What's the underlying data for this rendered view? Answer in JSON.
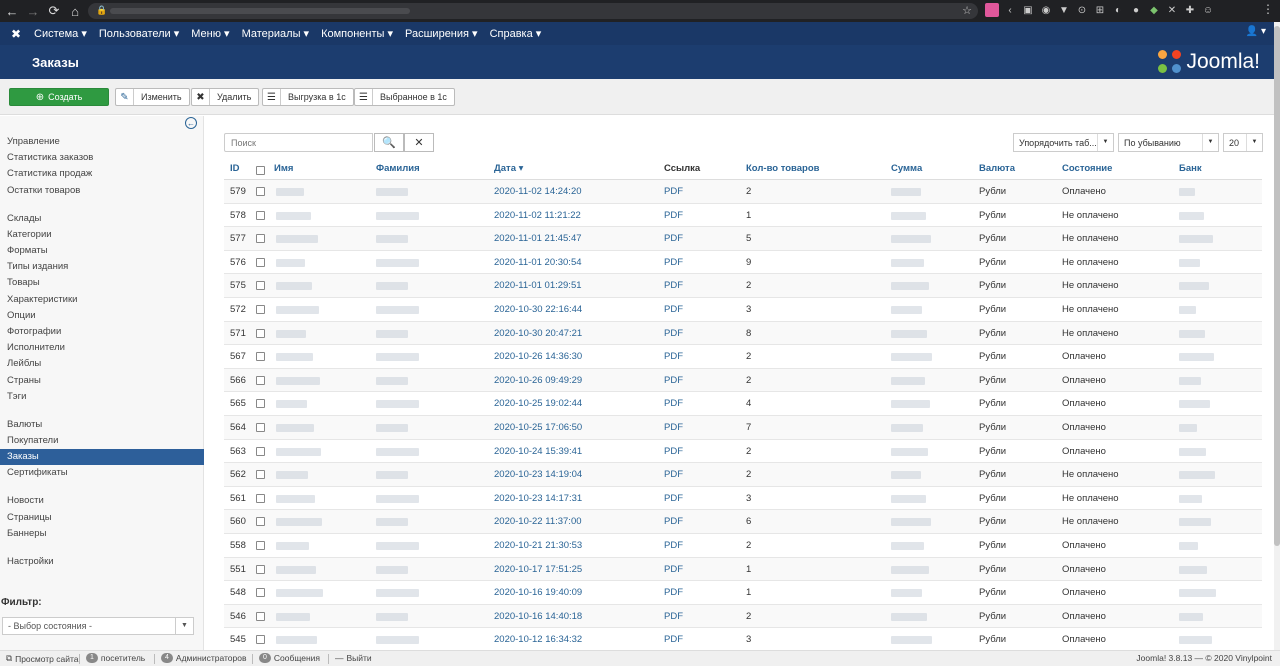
{
  "topnav": {
    "items": [
      "Система ▾",
      "Пользователи ▾",
      "Меню ▾",
      "Материалы ▾",
      "Компоненты ▾",
      "Расширения ▾",
      "Справка ▾"
    ],
    "user": "👤 ▾"
  },
  "header": {
    "title": "Заказы",
    "logo_text": "Joomla!"
  },
  "toolbar": {
    "create": "Создать",
    "edit": "Изменить",
    "delete": "Удалить",
    "export": "Выгрузка в 1с",
    "export_selected": "Выбранное в 1с"
  },
  "sidebar": {
    "items": [
      "Управление",
      "Статистика заказов",
      "Статистика продаж",
      "Остатки товаров",
      "Склады",
      "Категории",
      "Форматы",
      "Типы издания",
      "Товары",
      "Характеристики",
      "Опции",
      "Фотографии",
      "Исполнители",
      "Лейблы",
      "Страны",
      "Тэги",
      "Валюты",
      "Покупатели",
      "Заказы",
      "Сертификаты",
      "Новости",
      "Страницы",
      "Баннеры",
      "Настройки"
    ],
    "active": "Заказы",
    "filter_title": "Фильтр:",
    "filter_select": "- Выбор состояния -"
  },
  "search": {
    "placeholder": "Поиск"
  },
  "sorting": {
    "order_by": "Упорядочить таб...",
    "direction": "По убыванию",
    "limit": "20"
  },
  "table": {
    "headers": {
      "id": "ID",
      "first_name": "Имя",
      "last_name": "Фамилия",
      "date": "Дата ▾",
      "link": "Ссылка",
      "qty": "Кол-во товаров",
      "sum": "Сумма",
      "currency": "Валюта",
      "state": "Состояние",
      "bank": "Банк"
    },
    "rows": [
      {
        "id": "579",
        "date": "2020-11-02 14:24:20",
        "link": "PDF",
        "qty": "2",
        "currency": "Рубли",
        "state": "Оплачено"
      },
      {
        "id": "578",
        "date": "2020-11-02 11:21:22",
        "link": "PDF",
        "qty": "1",
        "currency": "Рубли",
        "state": "Не оплачено"
      },
      {
        "id": "577",
        "date": "2020-11-01 21:45:47",
        "link": "PDF",
        "qty": "5",
        "currency": "Рубли",
        "state": "Не оплачено"
      },
      {
        "id": "576",
        "date": "2020-11-01 20:30:54",
        "link": "PDF",
        "qty": "9",
        "currency": "Рубли",
        "state": "Не оплачено"
      },
      {
        "id": "575",
        "date": "2020-11-01 01:29:51",
        "link": "PDF",
        "qty": "2",
        "currency": "Рубли",
        "state": "Не оплачено"
      },
      {
        "id": "572",
        "date": "2020-10-30 22:16:44",
        "link": "PDF",
        "qty": "3",
        "currency": "Рубли",
        "state": "Не оплачено"
      },
      {
        "id": "571",
        "date": "2020-10-30 20:47:21",
        "link": "PDF",
        "qty": "8",
        "currency": "Рубли",
        "state": "Не оплачено"
      },
      {
        "id": "567",
        "date": "2020-10-26 14:36:30",
        "link": "PDF",
        "qty": "2",
        "currency": "Рубли",
        "state": "Оплачено"
      },
      {
        "id": "566",
        "date": "2020-10-26 09:49:29",
        "link": "PDF",
        "qty": "2",
        "currency": "Рубли",
        "state": "Оплачено"
      },
      {
        "id": "565",
        "date": "2020-10-25 19:02:44",
        "link": "PDF",
        "qty": "4",
        "currency": "Рубли",
        "state": "Оплачено"
      },
      {
        "id": "564",
        "date": "2020-10-25 17:06:50",
        "link": "PDF",
        "qty": "7",
        "currency": "Рубли",
        "state": "Оплачено"
      },
      {
        "id": "563",
        "date": "2020-10-24 15:39:41",
        "link": "PDF",
        "qty": "2",
        "currency": "Рубли",
        "state": "Оплачено"
      },
      {
        "id": "562",
        "date": "2020-10-23 14:19:04",
        "link": "PDF",
        "qty": "2",
        "currency": "Рубли",
        "state": "Не оплачено"
      },
      {
        "id": "561",
        "date": "2020-10-23 14:17:31",
        "link": "PDF",
        "qty": "3",
        "currency": "Рубли",
        "state": "Не оплачено"
      },
      {
        "id": "560",
        "date": "2020-10-22 11:37:00",
        "link": "PDF",
        "qty": "6",
        "currency": "Рубли",
        "state": "Не оплачено"
      },
      {
        "id": "558",
        "date": "2020-10-21 21:30:53",
        "link": "PDF",
        "qty": "2",
        "currency": "Рубли",
        "state": "Оплачено"
      },
      {
        "id": "551",
        "date": "2020-10-17 17:51:25",
        "link": "PDF",
        "qty": "1",
        "currency": "Рубли",
        "state": "Оплачено"
      },
      {
        "id": "548",
        "date": "2020-10-16 19:40:09",
        "link": "PDF",
        "qty": "1",
        "currency": "Рубли",
        "state": "Оплачено"
      },
      {
        "id": "546",
        "date": "2020-10-16 14:40:18",
        "link": "PDF",
        "qty": "2",
        "currency": "Рубли",
        "state": "Оплачено"
      },
      {
        "id": "545",
        "date": "2020-10-12 16:34:32",
        "link": "PDF",
        "qty": "3",
        "currency": "Рубли",
        "state": "Оплачено"
      }
    ]
  },
  "statusbar": {
    "view_site": "Просмотр сайта",
    "visitors_count": "1",
    "visitors_label": "посетитель",
    "admins_count": "4",
    "admins_label": "Администраторов",
    "messages_count": "0",
    "messages_label": "Сообщения",
    "logout": "Выйти",
    "version": "Joomla! 3.8.13 — © 2020 Vinylpoint"
  }
}
